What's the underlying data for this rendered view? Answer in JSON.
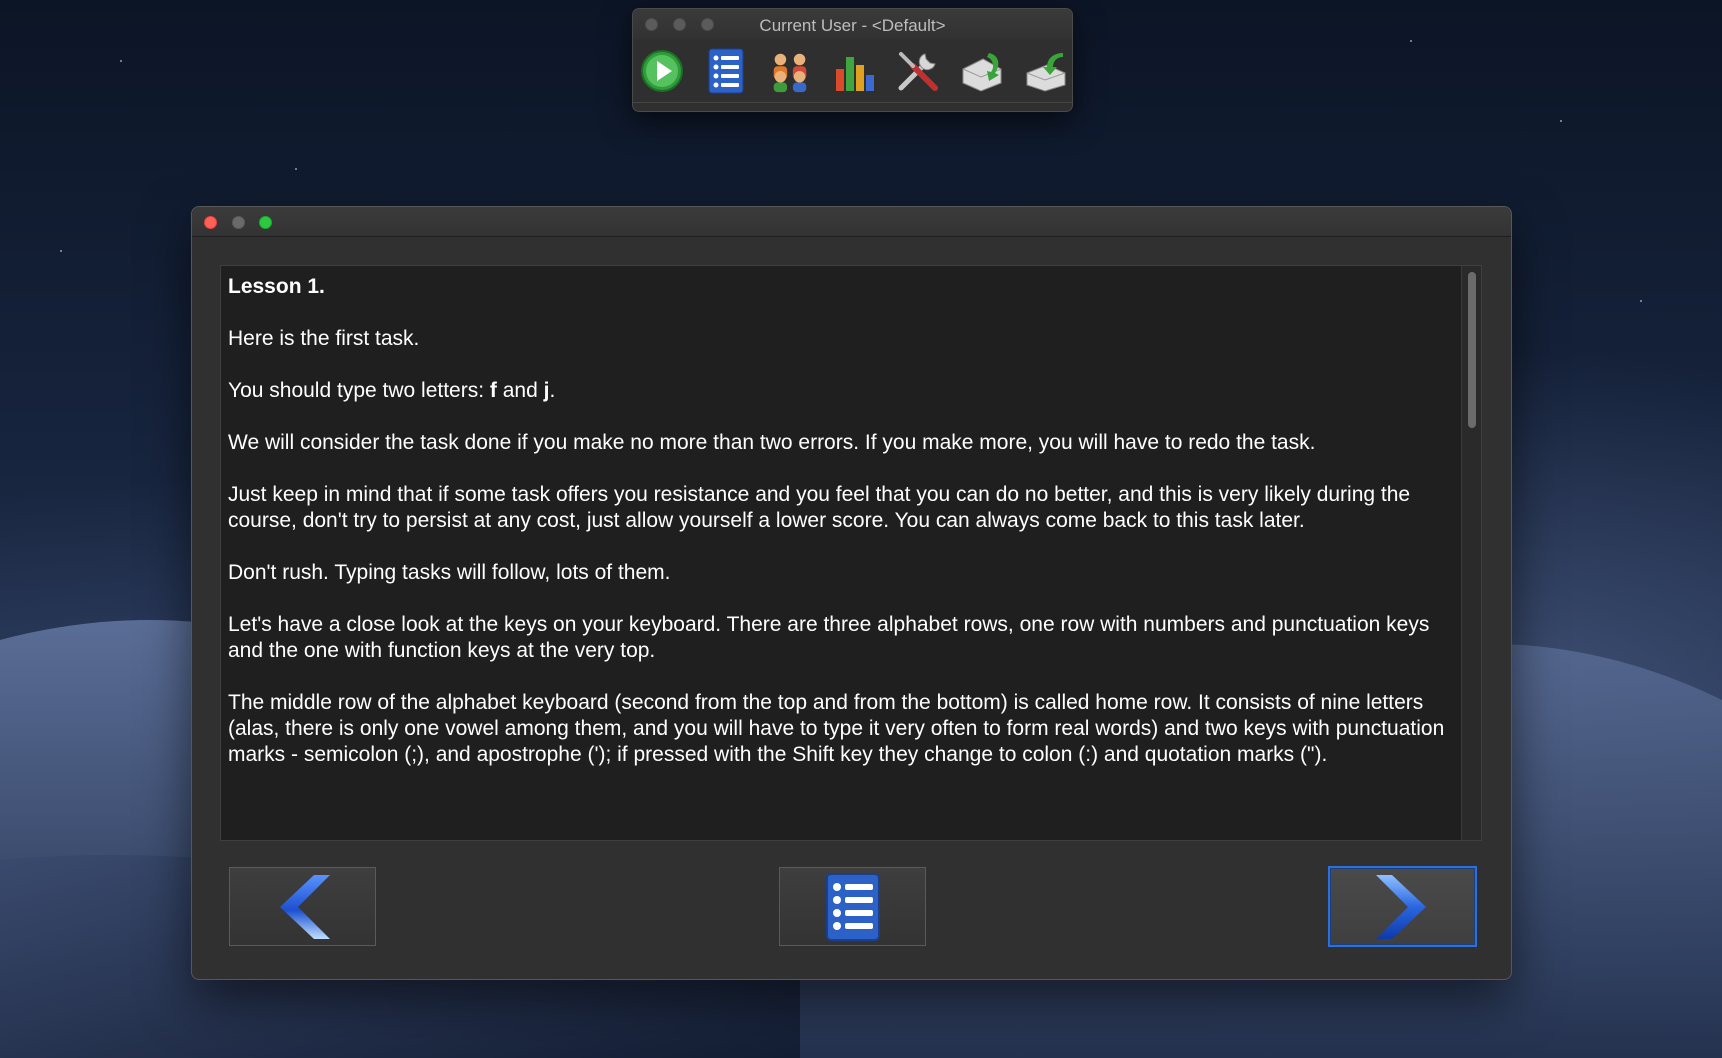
{
  "toolbar_window": {
    "title": "Current User - <Default>",
    "buttons": [
      {
        "icon": "play-icon"
      },
      {
        "icon": "list-icon"
      },
      {
        "icon": "users-icon"
      },
      {
        "icon": "bar-chart-icon"
      },
      {
        "icon": "tools-icon"
      },
      {
        "icon": "import-icon"
      },
      {
        "icon": "export-icon"
      }
    ]
  },
  "lesson": {
    "title": "Lesson 1.",
    "p1": "Here is the first task.",
    "p2_prefix": "You should type two letters: ",
    "p2_letter1": "f",
    "p2_and": " and ",
    "p2_letter2": "j",
    "p2_suffix": ".",
    "p3": "We will consider the task done if you make no more than two errors. If you make more, you will have to redo the task.",
    "p4": "Just keep in mind that if some task offers you resistance and you feel that you can do no better, and this is very likely during the course, don't try to persist at any cost, just allow yourself a lower score. You can always come back to this task later.",
    "p5": "Don't rush. Typing tasks will follow, lots of them.",
    "p6": "Let's have a close look at the keys on your keyboard. There are three alphabet rows, one row with numbers and punctuation keys and the one with function keys at the very top.",
    "p7": "The middle row of the alphabet keyboard (second from the top and from the bottom) is called home row. It consists of nine letters (alas, there is only one vowel among them, and you will have to type it very often to form real words) and two keys with punctuation marks - semicolon (;), and apostrophe ('); if pressed with the Shift key they change to colon (:) and quotation marks (\")."
  },
  "navigation": {
    "prev_icon": "chevron-left-icon",
    "list_icon": "list-icon",
    "next_icon": "chevron-right-icon"
  },
  "colors": {
    "accent_blue": "#2f6fd6",
    "close": "#fe5f57",
    "zoom": "#2ac940"
  }
}
